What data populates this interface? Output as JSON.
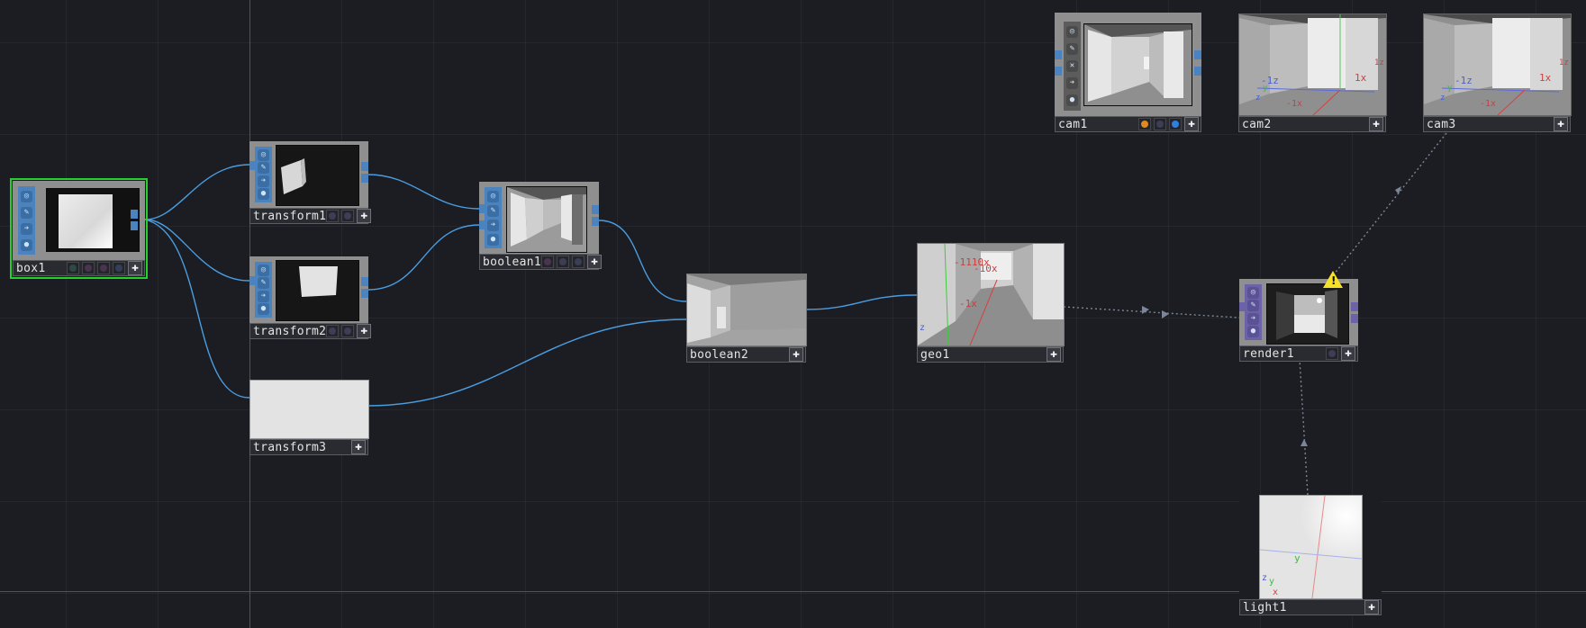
{
  "network": {
    "nodes": {
      "box1": "box1",
      "transform1": "transform1",
      "transform2": "transform2",
      "transform3": "transform3",
      "boolean1": "boolean1",
      "boolean2": "boolean2",
      "geo1": "geo1",
      "render1": "render1",
      "cam1": "cam1",
      "cam2": "cam2",
      "cam3": "cam3",
      "light1": "light1"
    },
    "viewer_labels": {
      "minus_1z": "-1z",
      "x1": "1x",
      "minus_1x": "-1x",
      "one_z": "1z",
      "z": "z",
      "y": "y",
      "x": "x",
      "geo_top": "-1110x",
      "geo_top2": "-10x",
      "geo_minus1x": "-1x"
    },
    "plus_glyph": "✚",
    "warning_glyph": "!"
  },
  "colors": {
    "background": "#1c1d22",
    "wire": "#4a9de0",
    "selection": "#22d12a",
    "sop_family": "#4b83be",
    "top_family": "#6b62a8",
    "warning": "#f5e02a",
    "flag_orange": "#e08a1e",
    "flag_blue": "#2f7fe0"
  }
}
